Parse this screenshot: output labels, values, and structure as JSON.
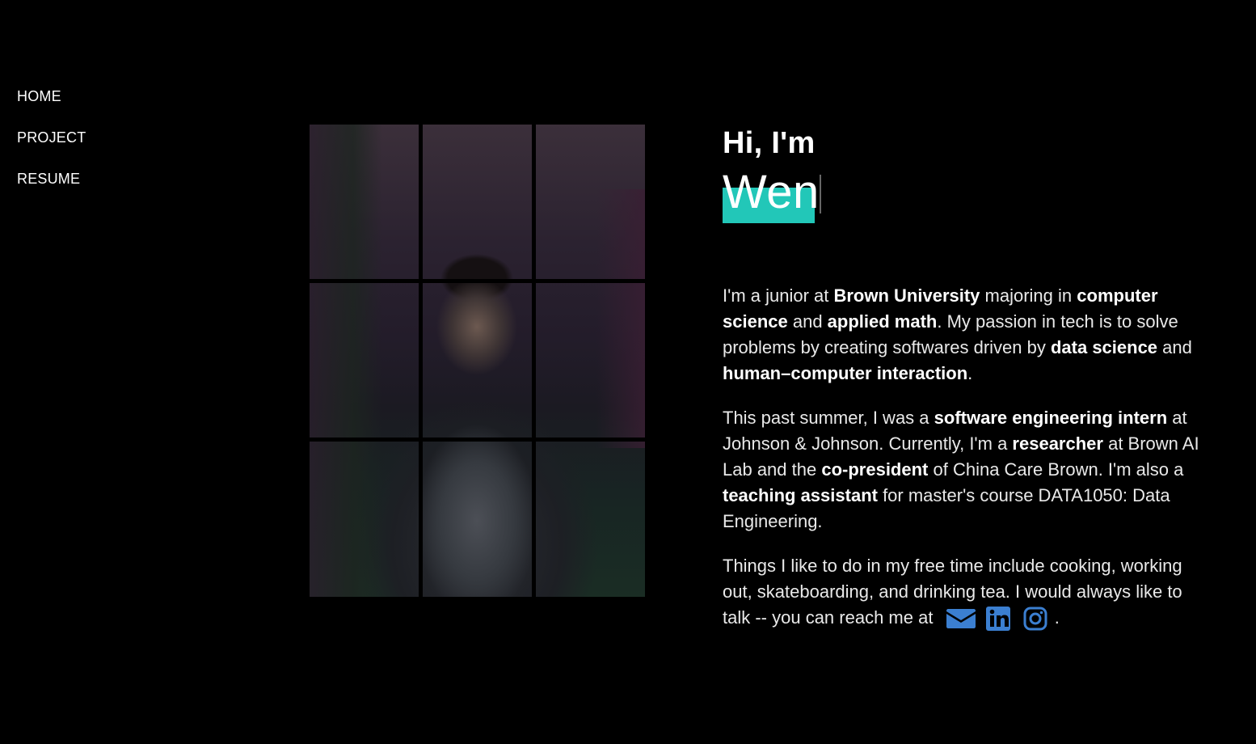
{
  "nav": {
    "items": [
      {
        "label": "HOME",
        "active": true
      },
      {
        "label": "PROJECT",
        "active": false
      },
      {
        "label": "RESUME",
        "active": false
      }
    ]
  },
  "hero": {
    "greeting": "Hi, I'm",
    "name": "Wen",
    "accent_color": "#22c7b8"
  },
  "bio": {
    "p1": [
      {
        "t": "I'm a junior at "
      },
      {
        "t": "Brown University",
        "b": true
      },
      {
        "t": " majoring in "
      },
      {
        "t": "computer science",
        "b": true
      },
      {
        "t": " and "
      },
      {
        "t": "applied math",
        "b": true
      },
      {
        "t": ". My passion in tech is to solve problems by creating softwares driven by "
      },
      {
        "t": "data science",
        "b": true
      },
      {
        "t": " and "
      },
      {
        "t": "human–computer interaction",
        "b": true
      },
      {
        "t": "."
      }
    ],
    "p2": [
      {
        "t": "This past summer, I was a "
      },
      {
        "t": "software engineering intern",
        "b": true
      },
      {
        "t": " at Johnson & Johnson. Currently, I'm a "
      },
      {
        "t": "researcher",
        "b": true
      },
      {
        "t": " at Brown AI Lab and the "
      },
      {
        "t": "co-president",
        "b": true
      },
      {
        "t": " of China Care Brown. I'm also a "
      },
      {
        "t": "teaching assistant",
        "b": true
      },
      {
        "t": " for master's course DATA1050: Data Engineering."
      }
    ],
    "p3_text": "Things I like to do in my free time include cooking, working out, skateboarding, and drinking tea. I would always like to talk -- you can reach me at",
    "p3_end": ".",
    "contact_icons": [
      "envelope-icon",
      "linkedin-icon",
      "instagram-icon"
    ],
    "icon_color": "#3b7fd1"
  }
}
